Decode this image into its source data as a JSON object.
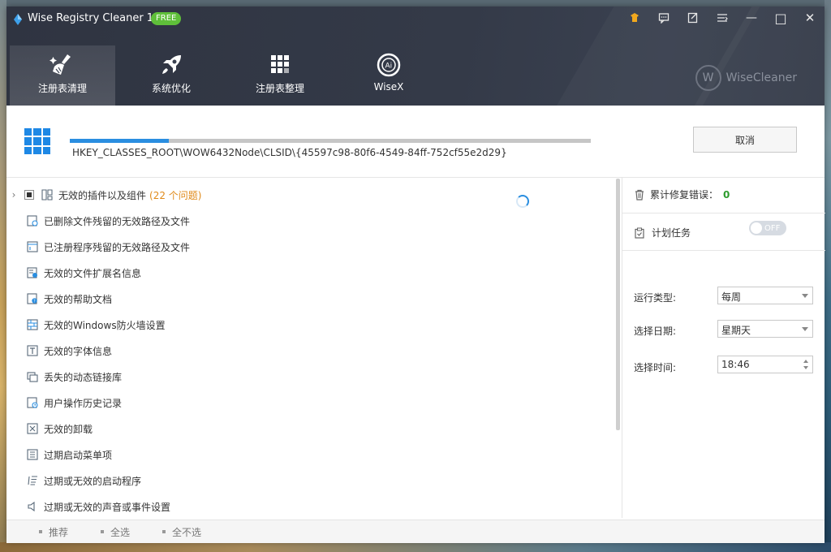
{
  "app": {
    "title": "Wise Registry Cleaner 11",
    "badge": "FREE"
  },
  "titlebar": {
    "upgrade_icon": "crown-icon",
    "feedback_icon": "feedback-icon",
    "notes_icon": "edit-icon",
    "menu_icon": "menu-icon",
    "minimize": "—",
    "maximize": "□",
    "close": "✕"
  },
  "nav": {
    "tabs": [
      {
        "label": "注册表清理",
        "icon": "broom-icon",
        "active": true
      },
      {
        "label": "系统优化",
        "icon": "rocket-icon",
        "active": false
      },
      {
        "label": "注册表整理",
        "icon": "grid-icon",
        "active": false
      },
      {
        "label": "WiseX",
        "icon": "wisex-icon",
        "active": false
      }
    ],
    "brand": "WiseCleaner",
    "brand_mark": "W"
  },
  "scan": {
    "path": "HKEY_CLASSES_ROOT\\WOW6432Node\\CLSID\\{45597c98-80f6-4549-84ff-752cf55e2d29}",
    "progress": 0.19,
    "cancel_label": "取消"
  },
  "items": [
    {
      "label": "无效的插件以及组件",
      "issues": "(22 个问题)",
      "icon": "plugin-icon",
      "expandable": true
    },
    {
      "label": "已删除文件残留的无效路径及文件",
      "icon": "deleted-file-icon"
    },
    {
      "label": "已注册程序残留的无效路径及文件",
      "icon": "program-icon"
    },
    {
      "label": "无效的文件扩展名信息",
      "icon": "file-extension-icon"
    },
    {
      "label": "无效的帮助文档",
      "icon": "help-doc-icon"
    },
    {
      "label": "无效的Windows防火墙设置",
      "icon": "firewall-icon"
    },
    {
      "label": "无效的字体信息",
      "icon": "font-icon"
    },
    {
      "label": "丢失的动态链接库",
      "icon": "dll-icon"
    },
    {
      "label": "用户操作历史记录",
      "icon": "history-icon"
    },
    {
      "label": "无效的卸载",
      "icon": "uninstall-icon"
    },
    {
      "label": "过期启动菜单项",
      "icon": "start-menu-icon"
    },
    {
      "label": "过期或无效的启动程序",
      "icon": "startup-icon"
    },
    {
      "label": "过期或无效的声音或事件设置",
      "icon": "sound-icon"
    }
  ],
  "right": {
    "stat_label": "累计修复错误：",
    "stat_value": "0",
    "plan_label": "计划任务",
    "toggle_label": "OFF",
    "run_type_label": "运行类型:",
    "run_type_value": "每周",
    "date_label": "选择日期:",
    "date_value": "星期天",
    "time_label": "选择时间:",
    "time_value": "18:46"
  },
  "footer": {
    "recommend": "推荐",
    "select_all": "全选",
    "select_none": "全不选"
  }
}
